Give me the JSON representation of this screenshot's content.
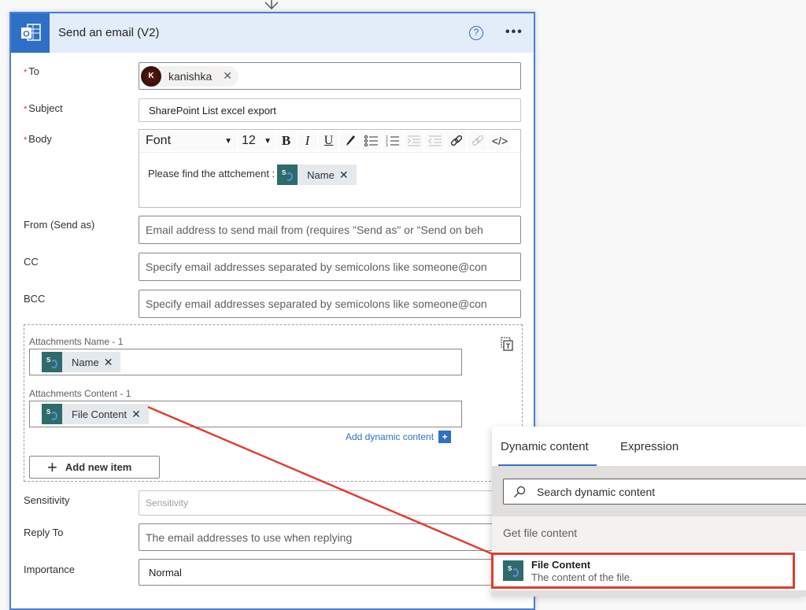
{
  "action": {
    "title": "Send an email (V2)",
    "help_label": "?",
    "more_label": "•••"
  },
  "fields": {
    "to": {
      "label": "To",
      "required_mark": "*",
      "recipient": {
        "initial": "K",
        "name": "kanishka"
      },
      "remove_glyph": "✕"
    },
    "subject": {
      "label": "Subject",
      "required_mark": "*",
      "value": "SharePoint List excel export"
    },
    "body": {
      "label": "Body",
      "required_mark": "*",
      "toolbar": {
        "font": "Font",
        "size": "12",
        "bold": "B",
        "italic": "I",
        "underline": "U",
        "code": "</>"
      },
      "text": "Please find the attchement :",
      "token": {
        "label": "Name",
        "remove_glyph": "✕"
      }
    },
    "from": {
      "label": "From (Send as)",
      "placeholder": "Email address to send mail from (requires \"Send as\" or \"Send on beh"
    },
    "cc": {
      "label": "CC",
      "placeholder": "Specify email addresses separated by semicolons like someone@con"
    },
    "bcc": {
      "label": "BCC",
      "placeholder": "Specify email addresses separated by semicolons like someone@con"
    },
    "attachments": {
      "name_label": "Attachments Name - 1",
      "name_token": "Name",
      "content_label": "Attachments Content - 1",
      "content_token": "File Content",
      "remove_glyph": "✕",
      "add_dynamic_label": "Add dynamic content",
      "add_dynamic_plus": "+",
      "add_item_label": "Add new item",
      "add_item_plus": "+"
    },
    "sensitivity": {
      "label": "Sensitivity",
      "placeholder": "Sensitivity"
    },
    "reply_to": {
      "label": "Reply To",
      "placeholder": "The email addresses to use when replying"
    },
    "importance": {
      "label": "Importance",
      "value": "Normal"
    }
  },
  "dynamic_panel": {
    "tabs": [
      {
        "label": "Dynamic content",
        "active": true
      },
      {
        "label": "Expression",
        "active": false
      }
    ],
    "search_placeholder": "Search dynamic content",
    "group": "Get file content",
    "items": [
      {
        "title": "File Content",
        "description": "The content of the file."
      }
    ]
  },
  "colors": {
    "accent": "#2f70c7",
    "header_bg": "#e3ecf9",
    "required": "#d13438",
    "annotation": "#e03e2d",
    "sharepoint_tile": "#2e6b6b"
  }
}
